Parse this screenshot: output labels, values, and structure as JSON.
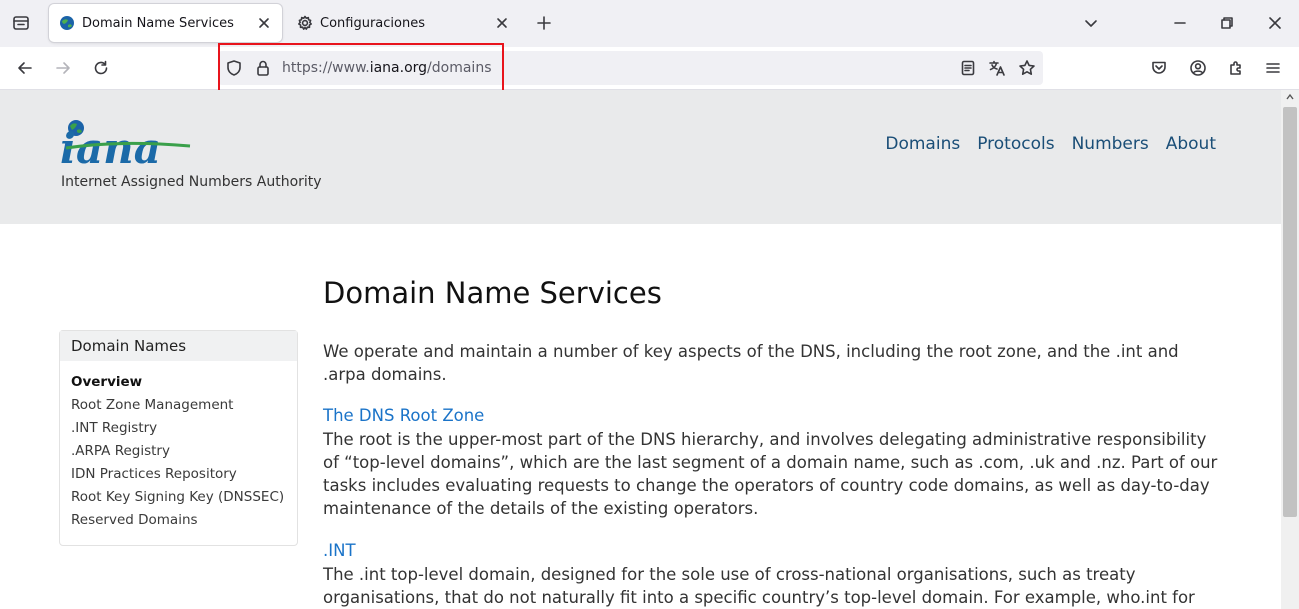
{
  "browser": {
    "tabs": [
      {
        "title": "Domain Name Services",
        "favicon": "iana-globe-icon",
        "active": true
      },
      {
        "title": "Configuraciones",
        "favicon": "gear-icon",
        "active": false
      }
    ],
    "url": {
      "scheme": "https://www.",
      "host": "iana.org",
      "path": "/domains"
    },
    "highlight_color": "#e8141c"
  },
  "site": {
    "logo_text": "iana",
    "logo_subtitle": "Internet Assigned Numbers Authority",
    "nav": [
      "Domains",
      "Protocols",
      "Numbers",
      "About"
    ]
  },
  "sidebar": {
    "title": "Domain Names",
    "items": [
      {
        "label": "Overview",
        "active": true
      },
      {
        "label": "Root Zone Management"
      },
      {
        "label": ".INT Registry"
      },
      {
        "label": ".ARPA Registry"
      },
      {
        "label": "IDN Practices Repository"
      },
      {
        "label": "Root Key Signing Key (DNSSEC)"
      },
      {
        "label": "Reserved Domains"
      }
    ]
  },
  "content": {
    "heading": "Domain Name Services",
    "intro": "We operate and maintain a number of key aspects of the DNS, including the root zone, and the .int and .arpa domains.",
    "sections": [
      {
        "title": "The DNS Root Zone",
        "body": "The root is the upper-most part of the DNS hierarchy, and involves delegating administrative responsibility of “top-level domains”, which are the last segment of a domain name, such as .com, .uk and .nz. Part of our tasks includes evaluating requests to change the operators of country code domains, as well as day-to-day maintenance of the details of the existing operators."
      },
      {
        "title": ".INT",
        "body": "The .int top-level domain, designed for the sole use of cross-national organisations, such as treaty organisations, that do not naturally fit into a specific country’s top-level domain. For example, who.int for the World Health"
      }
    ]
  }
}
